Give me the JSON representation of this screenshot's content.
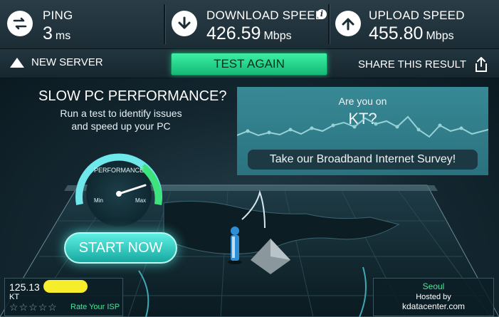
{
  "stats": {
    "ping": {
      "label": "PING",
      "value": "3",
      "unit": "ms"
    },
    "download": {
      "label": "DOWNLOAD SPEED",
      "value": "426.59",
      "unit": "Mbps",
      "info": "i"
    },
    "upload": {
      "label": "UPLOAD SPEED",
      "value": "455.80",
      "unit": "Mbps"
    }
  },
  "actions": {
    "new_server": "NEW SERVER",
    "test_again": "TEST AGAIN",
    "share": "SHARE THIS RESULT"
  },
  "promo": {
    "title": "SLOW PC PERFORMANCE?",
    "subtitle_line1": "Run a test to identify issues",
    "subtitle_line2": "and speed up your PC",
    "gauge_label": "PERFORMANCE",
    "gauge_min": "Min",
    "gauge_max": "Max",
    "start_button": "START NOW"
  },
  "survey": {
    "question": "Are you on",
    "isp": "KT?",
    "button": "Take our Broadband Internet Survey!"
  },
  "isp_info": {
    "ip": "125.13",
    "name": "KT",
    "rate_label": "Rate Your ISP",
    "stars": 5
  },
  "host": {
    "city": "Seoul",
    "hosted_by": "Hosted by",
    "hostname": "kdatacenter.com"
  },
  "colors": {
    "accent_green": "#14b874",
    "teal_panel": "#3a8f9c",
    "star_grey": "#8a9ea6",
    "highlight_yellow": "#f6ee2c"
  }
}
